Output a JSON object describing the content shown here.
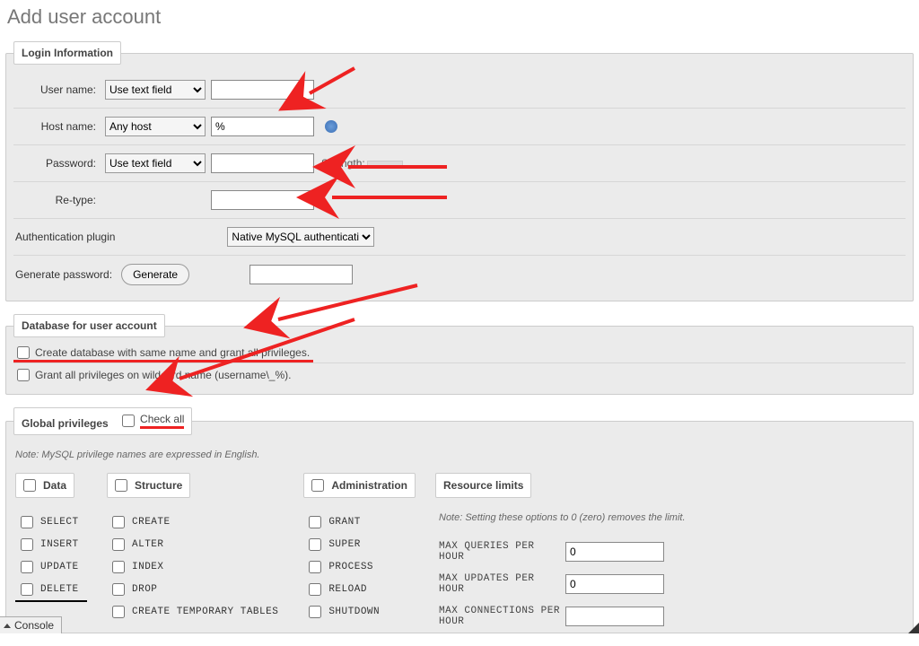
{
  "title": "Add user account",
  "login": {
    "legend": "Login Information",
    "username_label": "User name:",
    "username_select": "Use text field",
    "username_value": "",
    "hostname_label": "Host name:",
    "hostname_select": "Any host",
    "hostname_value": "%",
    "password_label": "Password:",
    "password_select": "Use text field",
    "password_value": "",
    "strength_label": "Strength:",
    "retype_label": "Re-type:",
    "retype_value": "",
    "auth_plugin_label": "Authentication plugin",
    "auth_plugin_select": "Native MySQL authentication",
    "gen_pw_label": "Generate password:",
    "gen_pw_button": "Generate",
    "gen_pw_value": ""
  },
  "db": {
    "legend": "Database for user account",
    "opt1": "Create database with same name and grant all privileges.",
    "opt2": "Grant all privileges on wildcard name (username\\_%)."
  },
  "global": {
    "legend": "Global privileges",
    "check_all": "Check all",
    "note": "Note: MySQL privilege names are expressed in English.",
    "data": {
      "head": "Data",
      "items": [
        "SELECT",
        "INSERT",
        "UPDATE",
        "DELETE"
      ]
    },
    "structure": {
      "head": "Structure",
      "items": [
        "CREATE",
        "ALTER",
        "INDEX",
        "DROP",
        "CREATE TEMPORARY TABLES"
      ]
    },
    "admin": {
      "head": "Administration",
      "items": [
        "GRANT",
        "SUPER",
        "PROCESS",
        "RELOAD",
        "SHUTDOWN"
      ]
    },
    "resources": {
      "head": "Resource limits",
      "note": "Note: Setting these options to 0 (zero) removes the limit.",
      "max_queries_label": "MAX QUERIES PER HOUR",
      "max_queries_value": "0",
      "max_updates_label": "MAX UPDATES PER HOUR",
      "max_updates_value": "0",
      "max_conn_label": "MAX CONNECTIONS PER HOUR",
      "max_conn_value": ""
    }
  },
  "console": "Console"
}
